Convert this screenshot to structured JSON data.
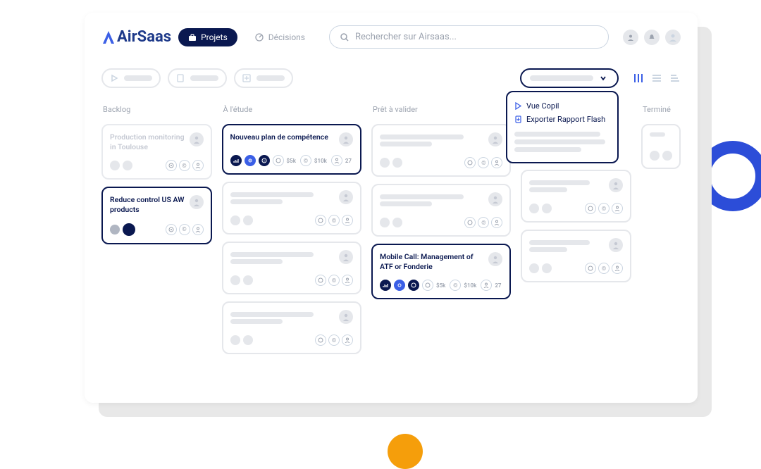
{
  "brand": {
    "name": "AirSaas",
    "accent": "#3b5fe6",
    "dark": "#0a1850"
  },
  "nav": {
    "projects": "Projets",
    "decisions": "Décisions"
  },
  "search": {
    "placeholder": "Rechercher sur Airsaas..."
  },
  "dropdown": {
    "items": [
      {
        "icon": "play",
        "label": "Vue Copil"
      },
      {
        "icon": "file",
        "label": "Exporter Rapport Flash"
      }
    ]
  },
  "columns": [
    {
      "key": "backlog",
      "label": "Backlog"
    },
    {
      "key": "etude",
      "label": "À l'étude"
    },
    {
      "key": "pret",
      "label": "Prêt à valider"
    },
    {
      "key": "lancement",
      "label": ""
    },
    {
      "key": "termine",
      "label": "Terminé"
    }
  ],
  "cards": {
    "prod_mon": {
      "title": "Production monitoring in Toulouse"
    },
    "reduce": {
      "title": "Reduce control US AW products"
    },
    "nouveau": {
      "title": "Nouveau plan de compétence",
      "v1": "$5k",
      "v2": "$10k",
      "v3": "27"
    },
    "mobile": {
      "title": "Mobile Call: Management of ATF or Fonderie",
      "v1": "$5k",
      "v2": "$10k",
      "v3": "27"
    }
  }
}
